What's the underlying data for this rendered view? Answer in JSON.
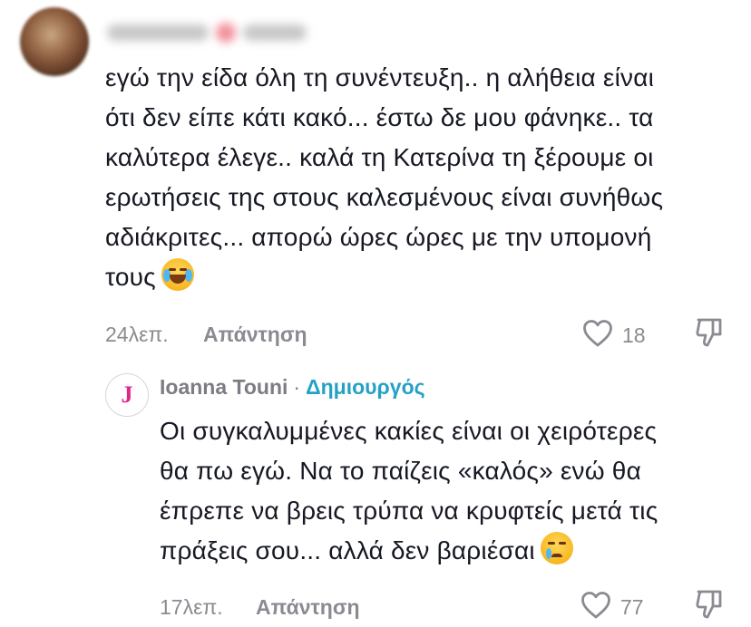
{
  "comment": {
    "author_name": "",
    "text": "εγώ την είδα όλη τη συνέντευξη.. η αλήθεια είναι\nότι δεν είπε κάτι κακό... έστω δε μου φάνηκε.. τα\nκαλύτερα έλεγε.. καλά τη Κατερίνα τη ξέρουμε οι\nερωτήσεις της στους καλεσμένους είναι συνήθως\nαδιάκριτες... απορώ ώρες ώρες με την υπομονή\nτους",
    "emoji": "face-with-tears-of-joy",
    "time": "24λεπ.",
    "reply_label": "Απάντηση",
    "likes": "18"
  },
  "reply": {
    "avatar_letter": "J",
    "author_name": "Ioanna Touni",
    "separator": "·",
    "creator_badge": "Δημιουργός",
    "text": "Οι συγκαλυμμένες κακίες είναι οι χειρότερες\nθα πω εγώ. Να το παίζεις «καλός» ενώ θα\nέπρεπε να βρεις τρύπα να κρυφτείς μετά τις\nπράξεις σου... αλλά δεν βαριέσαι",
    "emoji": "crying-face",
    "time": "17λεπ.",
    "reply_label": "Απάντηση",
    "likes": "77"
  },
  "colors": {
    "text": "#161823",
    "muted": "#8a8b91",
    "creator_badge": "#25a1c6",
    "avatar_letter": "#e0238a"
  },
  "icons": [
    "heart-outline-icon",
    "dislike-icon"
  ]
}
